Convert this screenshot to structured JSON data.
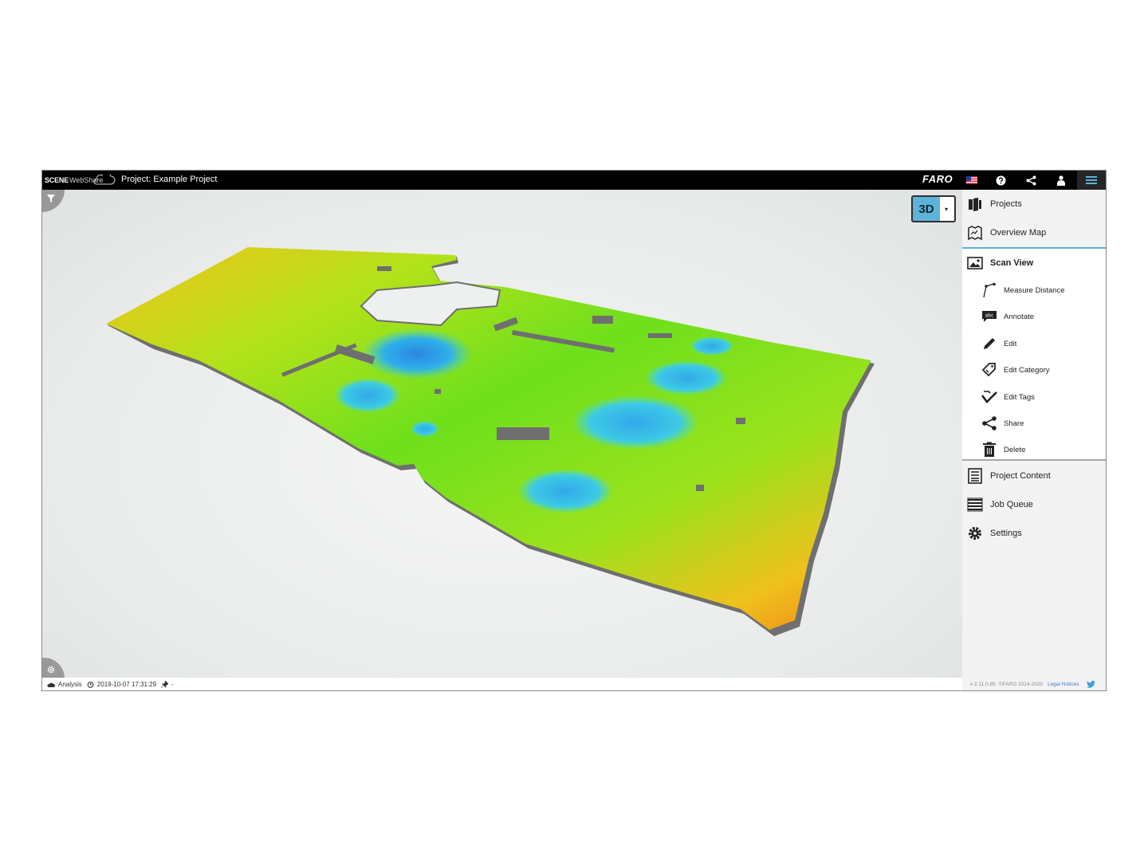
{
  "app": {
    "logo_scene": "SCENE",
    "logo_webshare": "WebShare",
    "project_title": "Project: Example Project",
    "brand": "FARO"
  },
  "topbar_icons": [
    "us-flag-icon",
    "help-icon",
    "share-icon",
    "user-icon",
    "hamburger-menu-icon"
  ],
  "viewport": {
    "view_mode": "3D",
    "view_mode_caret": "▾"
  },
  "status": {
    "source": "Analysis",
    "datetime": "2019-10-07 17:31:29",
    "pin_value": "-"
  },
  "menu": {
    "projects": "Projects",
    "overview_map": "Overview Map",
    "scan_view": "Scan View",
    "measure_distance": "Measure Distance",
    "annotate": "Annotate",
    "annotate_badge": "abc",
    "edit": "Edit",
    "edit_category": "Edit Category",
    "edit_tags": "Edit Tags",
    "share": "Share",
    "delete": "Delete",
    "project_content": "Project Content",
    "job_queue": "Job Queue",
    "settings": "Settings"
  },
  "footer": {
    "version": "v 2.11.0.65",
    "copyright": "©FARO 2014-2020",
    "legal": "Legal Notices"
  },
  "colors": {
    "accent": "#5fb3d8",
    "topbar": "#000000",
    "sidebar": "#f3f3f3",
    "heat_low": "#2aa8e8",
    "heat_mid": "#7ee01a",
    "heat_high": "#f29a1a"
  }
}
